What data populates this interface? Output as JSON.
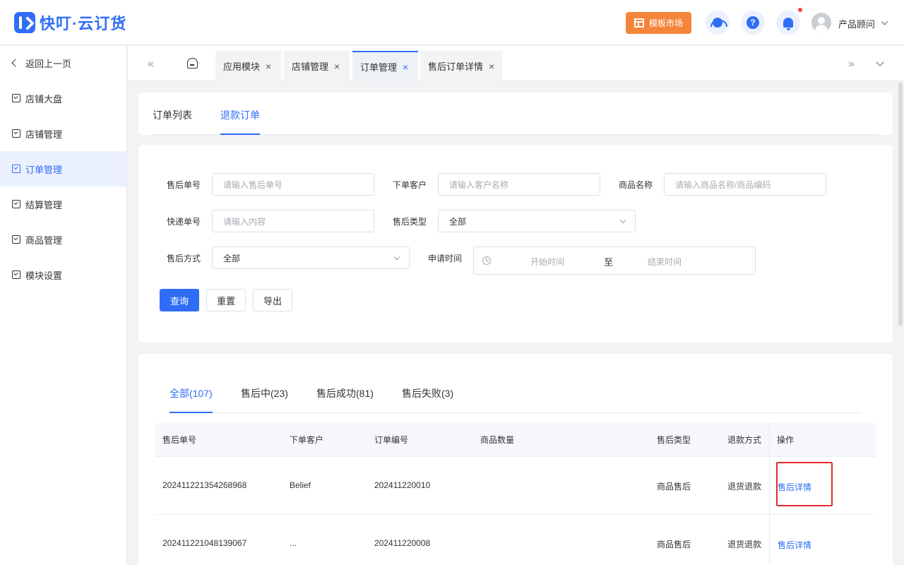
{
  "app": {
    "brand": "快叮·云订货",
    "market_label": "模板市场",
    "user_name": "产品顾问"
  },
  "sidebar": {
    "back_label": "返回上一页",
    "items": [
      {
        "label": "店铺大盘",
        "active": false
      },
      {
        "label": "店铺管理",
        "active": false
      },
      {
        "label": "订单管理",
        "active": true
      },
      {
        "label": "结算管理",
        "active": false
      },
      {
        "label": "商品管理",
        "active": false
      },
      {
        "label": "模块设置",
        "active": false
      }
    ]
  },
  "tabs": [
    {
      "label": "应用模块",
      "close": "×",
      "active": false
    },
    {
      "label": "店铺管理",
      "close": "×",
      "active": false
    },
    {
      "label": "订单管理",
      "close": "×",
      "active": true
    },
    {
      "label": "售后订单详情",
      "close": "×",
      "active": false
    }
  ],
  "tabstrip": {
    "prev": "«",
    "next": "»"
  },
  "subtabs": [
    {
      "label": "订单列表",
      "active": false
    },
    {
      "label": "退款订单",
      "active": true
    }
  ],
  "filters": {
    "aftersale_no": {
      "label": "售后单号",
      "placeholder": "请输入售后单号"
    },
    "customer": {
      "label": "下单客户",
      "placeholder": "请输入客户名称"
    },
    "product": {
      "label": "商品名称",
      "placeholder": "请输入商品名称/商品编码"
    },
    "express_no": {
      "label": "快递单号",
      "placeholder": "请输入内容"
    },
    "aftersale_type": {
      "label": "售后类型",
      "value": "全部"
    },
    "aftersale_method": {
      "label": "售后方式",
      "value": "全部"
    },
    "apply_time": {
      "label": "申请时间",
      "start_placeholder": "开始时间",
      "separator": "至",
      "end_placeholder": "结束时间"
    }
  },
  "buttons": {
    "query": "查询",
    "reset": "重置",
    "export": "导出"
  },
  "status_tabs": [
    {
      "label": "全部(107)",
      "active": true
    },
    {
      "label": "售后中(23)",
      "active": false
    },
    {
      "label": "售后成功(81)",
      "active": false
    },
    {
      "label": "售后失败(3)",
      "active": false
    }
  ],
  "table": {
    "columns": [
      "售后单号",
      "下单客户",
      "订单编号",
      "商品数量",
      "售后类型",
      "退款方式",
      "操作"
    ],
    "rows": [
      {
        "aftersale_no": "202411221354268968",
        "customer": "Belief",
        "order_no": "202411220010",
        "qty": "",
        "type": "商品售后",
        "refund_method": "退货退款",
        "action": "售后详情"
      },
      {
        "aftersale_no": "202411221048139067",
        "customer": "...",
        "order_no": "202411220008",
        "qty": "",
        "type": "商品售后",
        "refund_method": "退货退款",
        "action": "售后详情"
      }
    ]
  },
  "colors": {
    "primary": "#2f6df6",
    "market": "#f4853b",
    "highlight": "#e02b2b"
  }
}
